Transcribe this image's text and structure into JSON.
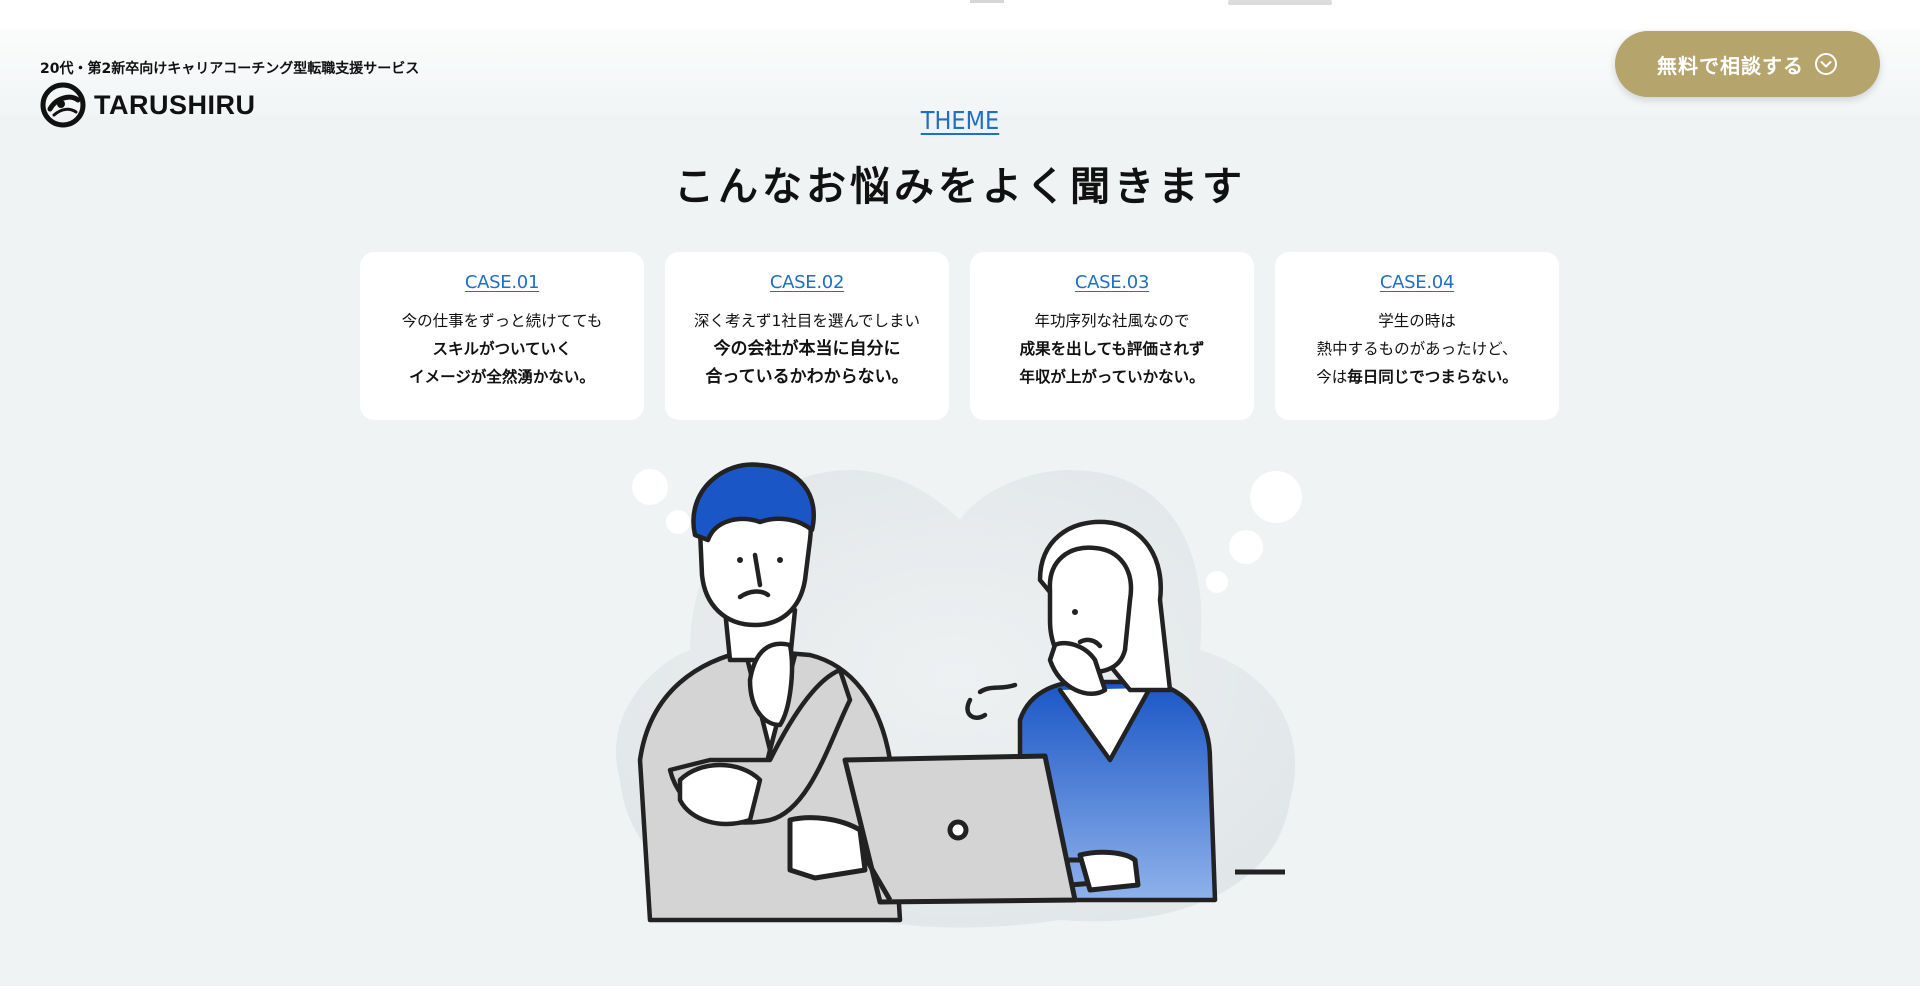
{
  "header": {
    "tagline": "20代・第2新卒向けキャリアコーチング型転職支援サービス",
    "logo_text": "TARUSHIRU",
    "cta_label": "無料で相談する"
  },
  "section": {
    "eyebrow": "THEME",
    "heading": "こんなお悩みをよく聞きます"
  },
  "cases": [
    {
      "title": "CASE.01",
      "lines": [
        "今の仕事をずっと続けてても",
        "スキルがついていく",
        "イメージが全然湧かない。"
      ]
    },
    {
      "title": "CASE.02",
      "lines": [
        "深く考えず1社目を選んでしまい",
        "今の会社が本当に自分に",
        "合っているかわからない。"
      ]
    },
    {
      "title": "CASE.03",
      "lines": [
        "年功序列な社風なので",
        "成果を出しても評価されず",
        "年収が上がっていかない。"
      ]
    },
    {
      "title": "CASE.04",
      "lines": [
        "学生の時は",
        "熱中するものがあったけど、",
        "今は",
        "毎日同じでつまらない。"
      ]
    }
  ],
  "colors": {
    "accent_blue": "#1f6fc4",
    "cta_gold": "#b5a46c",
    "page_bg": "#eff3f4",
    "illus_blue": "#1a56c6"
  },
  "icons": {
    "cta": "chevron-down-circle-icon",
    "logo": "swirl-logo-icon"
  }
}
